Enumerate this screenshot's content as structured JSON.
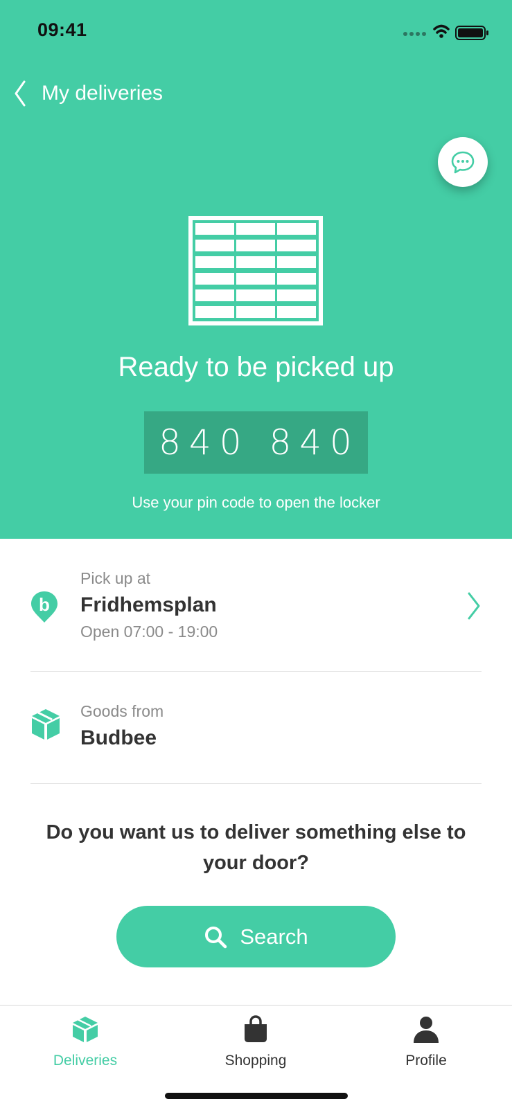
{
  "status_bar": {
    "time": "09:41"
  },
  "nav": {
    "back_title": "My deliveries"
  },
  "hero": {
    "status_title": "Ready to be picked up",
    "pin_code": "840 840",
    "pin_hint": "Use your pin code to open the locker"
  },
  "pickup": {
    "label": "Pick up at",
    "location": "Fridhemsplan",
    "hours": "Open 07:00 - 19:00"
  },
  "goods": {
    "label": "Goods from",
    "merchant": "Budbee"
  },
  "promo": {
    "question": "Do you want us to deliver something else to your door?",
    "search_label": "Search"
  },
  "tabs": [
    {
      "label": "Deliveries",
      "icon": "box-icon",
      "active": true
    },
    {
      "label": "Shopping",
      "icon": "bag-icon",
      "active": false
    },
    {
      "label": "Profile",
      "icon": "person-icon",
      "active": false
    }
  ],
  "colors": {
    "accent": "#44CDA5",
    "pin_background": "#36A884",
    "text_dark": "#333333",
    "text_muted": "#8A8A8A"
  }
}
